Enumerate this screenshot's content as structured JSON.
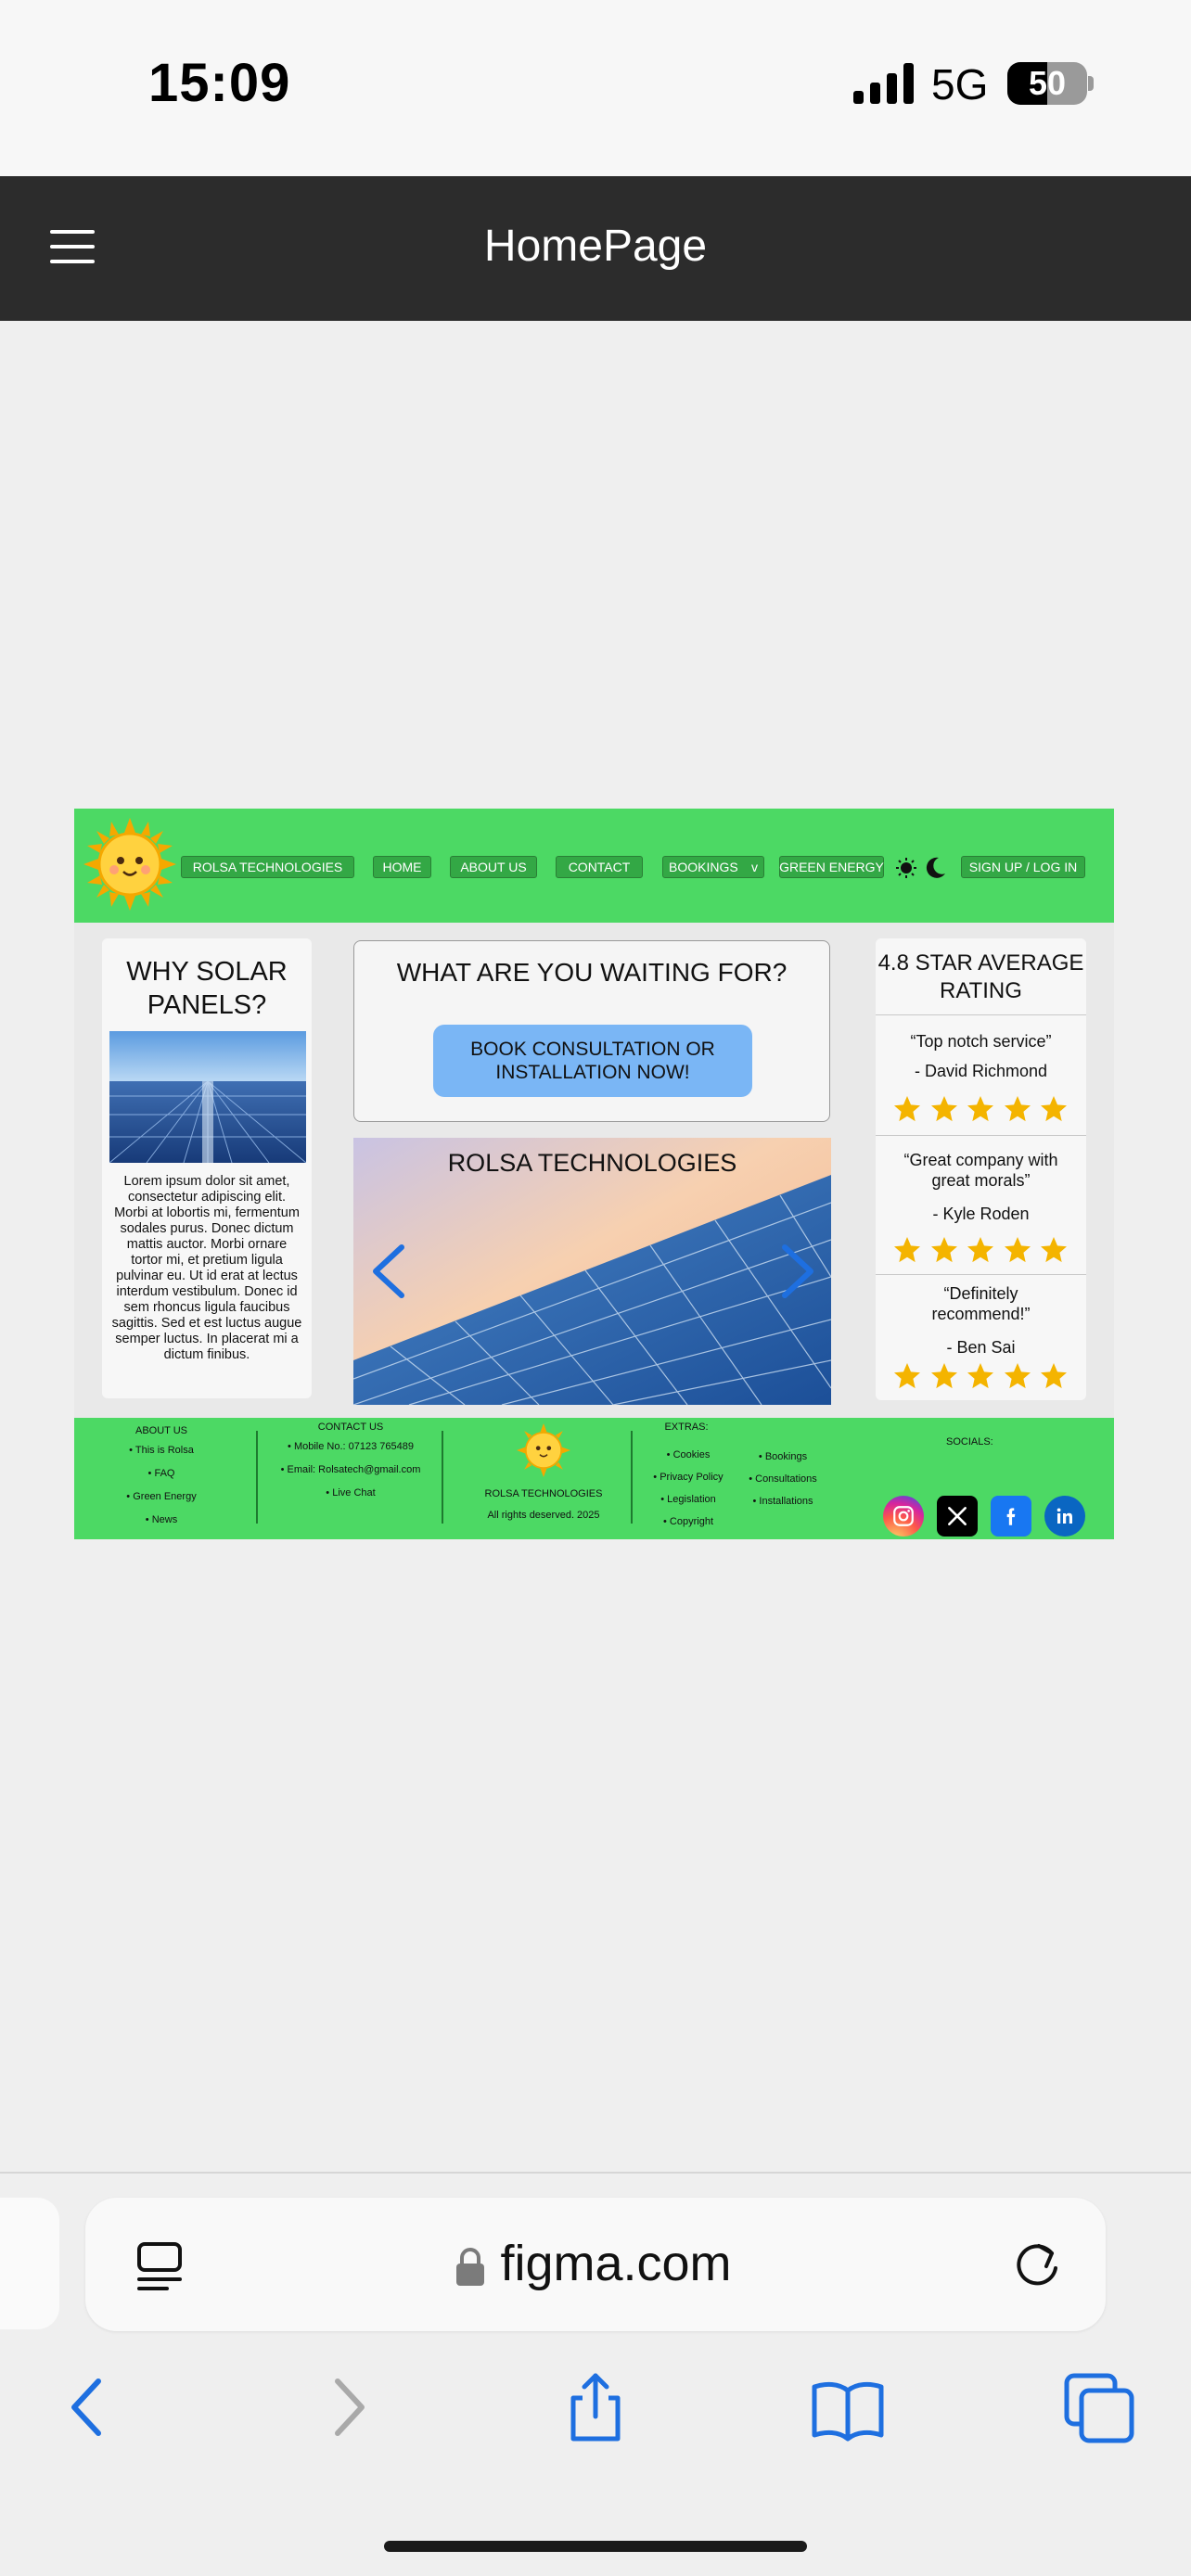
{
  "status_bar": {
    "time": "15:09",
    "network": "5G",
    "battery": "50",
    "battery_level": 0.5
  },
  "figma_bar": {
    "title": "HomePage"
  },
  "site": {
    "nav": {
      "items": [
        "ROLSA TECHNOLOGIES",
        "HOME",
        "ABOUT US",
        "CONTACT",
        "BOOKINGS",
        "GREEN ENERGY"
      ],
      "bookings_caret": "v",
      "signup": "SIGN UP / LOG IN"
    },
    "why_solar": {
      "title": "WHY SOLAR PANELS?",
      "body": "Lorem ipsum dolor sit amet, consectetur adipiscing elit. Morbi at lobortis mi, fermentum sodales purus. Donec dictum mattis auctor. Morbi ornare tortor mi, et pretium ligula pulvinar eu. Ut id erat at lectus interdum vestibulum. Donec id sem rhoncus ligula faucibus sagittis. Sed et est luctus augue semper luctus. In placerat mi a dictum finibus."
    },
    "cta": {
      "title": "WHAT ARE YOU WAITING FOR?",
      "button": "BOOK CONSULTATION OR INSTALLATION NOW!"
    },
    "slider": {
      "caption": "ROLSA TECHNOLOGIES"
    },
    "rating": {
      "title": "4.8 STAR AVERAGE RATING",
      "reviews": [
        {
          "quote": "“Top notch service”",
          "name": "- David Richmond",
          "stars": 5
        },
        {
          "quote": "“Great company with great morals”",
          "name": "- Kyle Roden",
          "stars": 5
        },
        {
          "quote": "“Definitely recommend!”",
          "name": "- Ben Sai",
          "stars": 5
        }
      ]
    },
    "footer": {
      "about": {
        "heading": "ABOUT US",
        "items": [
          "This is Rolsa",
          "FAQ",
          "Green Energy",
          "News"
        ]
      },
      "contact": {
        "heading": "CONTACT US",
        "items": [
          "Mobile No.: 07123 765489",
          "Email: Rolsatech@gmail.com",
          "Live Chat"
        ]
      },
      "brand": {
        "name": "ROLSA TECHNOLOGIES",
        "rights": "All rights deserved. 2025"
      },
      "extras": {
        "heading": "EXTRAS:",
        "col1": [
          "Cookies",
          "Privacy Policy",
          "Legislation",
          "Copyright"
        ],
        "col2": [
          "Bookings",
          "Consultations",
          "Installations"
        ]
      },
      "socials": {
        "heading": "SOCIALS:",
        "icons": [
          "instagram-icon",
          "x-icon",
          "facebook-icon",
          "linkedin-icon"
        ]
      }
    },
    "colors": {
      "green": "#4cd964",
      "button_green": "#33a845",
      "cta_blue": "#7ab6f5",
      "star": "#f4b400",
      "arrow_blue": "#1e6fe0"
    }
  },
  "safari": {
    "url": "figma.com"
  }
}
